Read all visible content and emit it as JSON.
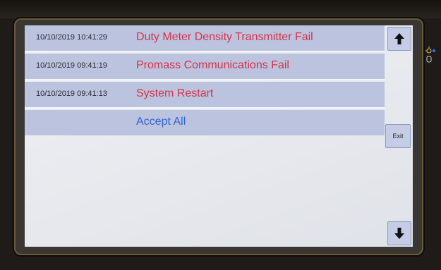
{
  "alarms": [
    {
      "timestamp": "10/10/2019 10:41:29",
      "message": "Duty Meter Density Transmitter Fail"
    },
    {
      "timestamp": "10/10/2019 09:41:19",
      "message": "Promass Communications Fail"
    },
    {
      "timestamp": "10/10/2019 09:41:13",
      "message": "System Restart"
    }
  ],
  "accept_label": "Accept All",
  "exit_label": "Exit",
  "colors": {
    "alarm_text": "#d4334a",
    "accept_text": "#2f63d6",
    "row_background": "#bcc3df",
    "screen_background": "#e6e8ed"
  },
  "icons": {
    "scroll_up": "arrow-up-icon",
    "scroll_down": "arrow-down-icon",
    "indicator": "led-indicator-icon"
  }
}
